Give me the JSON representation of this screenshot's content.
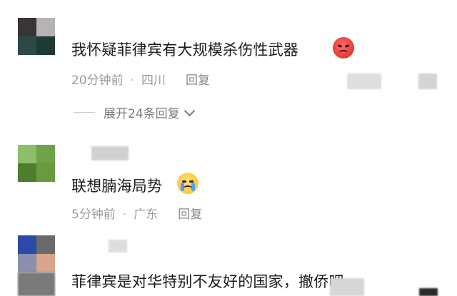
{
  "comments": [
    {
      "text": "我怀疑菲律宾有大规模杀伤性武器",
      "emoji": "angry-face-icon",
      "time": "20分钟前",
      "location": "四川",
      "reply_label": "回复",
      "expand_label": "展开24条回复"
    },
    {
      "text": "联想腩海局势",
      "emoji": "crying-face-icon",
      "time": "5分钟前",
      "location": "广东",
      "reply_label": "回复"
    },
    {
      "text": "菲律宾是对华特别不友好的国家，撤侨吧"
    }
  ],
  "separator": "·",
  "colors": {
    "text": "#1b1b1b",
    "meta": "#9a9a9a",
    "angry_emoji": "#e53935",
    "crying_emoji": "#ffc83d"
  }
}
